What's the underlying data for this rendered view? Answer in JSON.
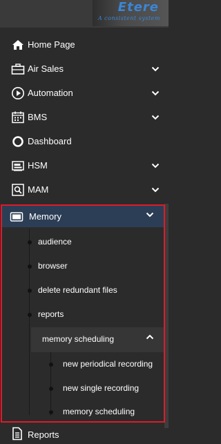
{
  "logo": {
    "name": "Etere",
    "tagline": "A consistent system"
  },
  "menu": {
    "items": [
      {
        "label": "Home Page",
        "icon": "home-icon",
        "has_chevron": false
      },
      {
        "label": "Air Sales",
        "icon": "briefcase-icon",
        "has_chevron": true
      },
      {
        "label": "Automation",
        "icon": "play-circle-icon",
        "has_chevron": true
      },
      {
        "label": "BMS",
        "icon": "calendar-icon",
        "has_chevron": true
      },
      {
        "label": "Dashboard",
        "icon": "circle-icon",
        "has_chevron": false
      },
      {
        "label": "HSM",
        "icon": "storage-icon",
        "has_chevron": true
      },
      {
        "label": "MAM",
        "icon": "search-file-icon",
        "has_chevron": true
      }
    ],
    "memory": {
      "label": "Memory",
      "expanded": true,
      "children": [
        {
          "label": "audience"
        },
        {
          "label": "browser"
        },
        {
          "label": "delete redundant files"
        },
        {
          "label": "reports"
        }
      ],
      "group": {
        "label": "memory scheduling",
        "expanded": true,
        "children": [
          {
            "label": "new periodical recording"
          },
          {
            "label": "new single recording"
          },
          {
            "label": "memory scheduling"
          }
        ]
      }
    },
    "reports": {
      "label": "Reports"
    }
  },
  "colors": {
    "background": "#2b2b2b",
    "active_header": "#2c3e55",
    "highlight_border": "#e01a2a",
    "brand": "#3b86d6"
  }
}
